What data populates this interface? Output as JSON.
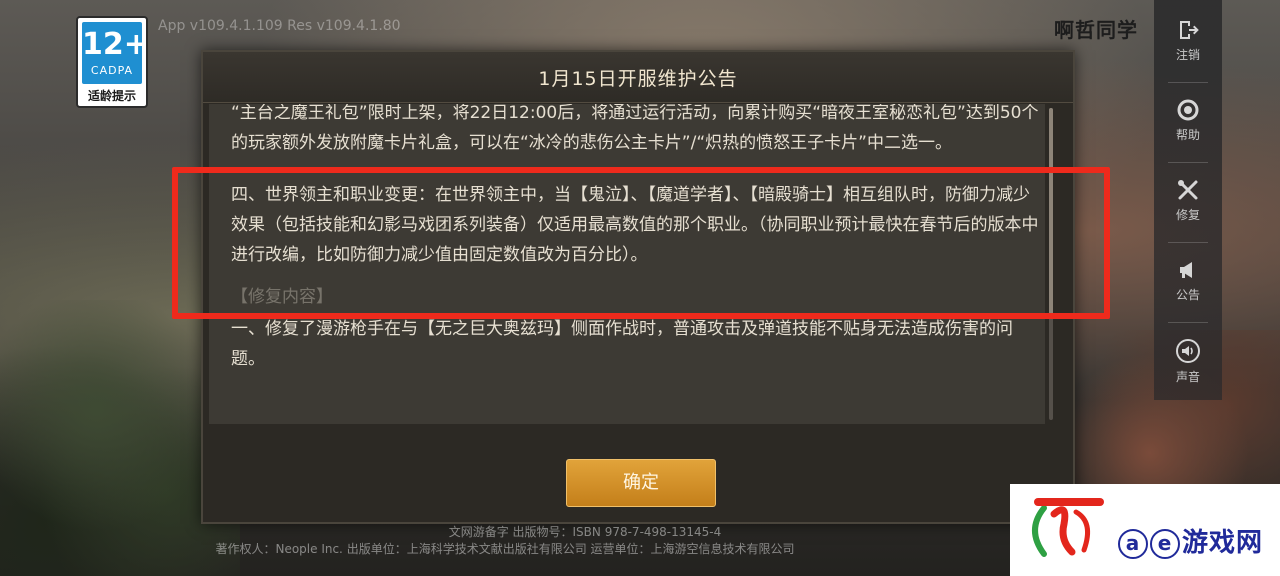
{
  "background": {
    "version_text": "App v109.4.1.109 Res v109.4.1.80"
  },
  "age_badge": {
    "number": "12+",
    "org": "CADPA",
    "label": "适龄提示"
  },
  "user": {
    "name": "啊哲同学"
  },
  "rail": {
    "items": [
      {
        "label": "注销",
        "icon": "logout-icon"
      },
      {
        "label": "帮助",
        "icon": "help-icon"
      },
      {
        "label": "修复",
        "icon": "wrench-icon"
      },
      {
        "label": "公告",
        "icon": "megaphone-icon"
      },
      {
        "label": "声音",
        "icon": "speaker-icon"
      }
    ]
  },
  "dialog": {
    "title": "1月15日开服维护公告",
    "paragraphs": {
      "top_partial": "“主台之魔王礼包”限时上架，将22日12:00后，将通过运行活动，向累计购买“暗夜王室秘恋礼包”达到50个的玩家额外发放附魔卡片礼盒，可以在“冰冷的悲伤公主卡片”/“炽热的愤怒王子卡片”中二选一。",
      "highlighted": "四、世界领主和职业变更：在世界领主中，当【鬼泣】、【魔道学者】、【暗殿骑士】相互组队时，防御力减少效果（包括技能和幻影马戏团系列装备）仅适用最高数值的那个职业。（协同职业预计最快在春节后的版本中进行改编，比如防御力减少值由固定数值改为百分比）。",
      "fix_heading": "【修复内容】",
      "fix_item_1": "一、修复了漫游枪手在与【无之巨大奥兹玛】侧面作战时，普通攻击及弹道技能不贴身无法造成伤害的问题。"
    },
    "confirm_label": "确定"
  },
  "footer": {
    "line1": "文网游备字 出版物号：ISBN 978-7-498-13145-4",
    "line2": "著作权人：Neople Inc. 出版单位：上海科学技术文献出版社有限公司 运营单位：上海游空信息技术有限公司"
  },
  "watermark": {
    "text": "ⓐⓔ游戏网",
    "circle_a": "a",
    "circle_e": "e",
    "suffix": "游戏网",
    "colors": {
      "red": "#e3261c",
      "blue": "#202a9a",
      "green": "#2ea043"
    }
  },
  "colors": {
    "highlight_border": "#ee2a1c",
    "button_gold": "#d69227",
    "dialog_bg": "#2c2924"
  }
}
